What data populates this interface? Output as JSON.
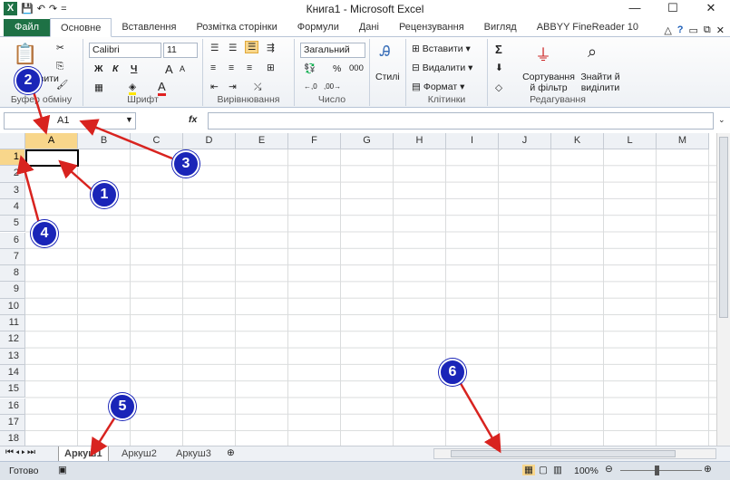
{
  "window": {
    "title": "Книга1 - Microsoft Excel",
    "controls": [
      "—",
      "☐",
      "✕"
    ],
    "qat": [
      "X",
      "💾",
      "↶",
      "↷",
      "="
    ]
  },
  "ribbon_tabs": [
    {
      "label": "Файл",
      "type": "file"
    },
    {
      "label": "Основне",
      "type": "active"
    },
    {
      "label": "Вставлення"
    },
    {
      "label": "Розмітка сторінки"
    },
    {
      "label": "Формули"
    },
    {
      "label": "Дані"
    },
    {
      "label": "Рецензування"
    },
    {
      "label": "Вигляд"
    },
    {
      "label": "ABBYY FineReader 10"
    }
  ],
  "ribbon_right_icons": [
    "△",
    "?",
    "▭",
    "⧉",
    "✕"
  ],
  "groups": {
    "clipboard": {
      "label": "Буфер обміну",
      "paste": "Вставити"
    },
    "font": {
      "label": "Шрифт",
      "font_name": "Calibri",
      "font_size": "11",
      "bold": "Ж",
      "italic": "К",
      "underline": "Ч",
      "grow": "A",
      "shrink": "A",
      "color_a": "A"
    },
    "alignment": {
      "label": "Вирівнювання"
    },
    "number": {
      "label": "Число",
      "format": "Загальний",
      "percent": "%",
      "thousands": "000"
    },
    "styles": {
      "label": "Стилі"
    },
    "cells": {
      "label": "Клітинки",
      "insert": "Вставити",
      "delete": "Видалити",
      "format": "Формат"
    },
    "editing": {
      "label": "Редагування",
      "sigma": "Σ",
      "sort": "Сортування й фільтр",
      "find": "Знайти й виділити"
    }
  },
  "formula_bar": {
    "name_box": "A1",
    "fx": "fx",
    "value": ""
  },
  "columns": [
    "A",
    "B",
    "C",
    "D",
    "E",
    "F",
    "G",
    "H",
    "I",
    "J",
    "K",
    "L",
    "M"
  ],
  "rows": [
    "1",
    "2",
    "3",
    "4",
    "5",
    "6",
    "7",
    "8",
    "9",
    "10",
    "11",
    "12",
    "13",
    "14",
    "15",
    "16",
    "17",
    "18"
  ],
  "sheets": {
    "tabs": [
      "Аркуш1",
      "Аркуш2",
      "Аркуш3"
    ],
    "active": "Аркуш1"
  },
  "status": {
    "ready": "Готово",
    "zoom": "100%"
  },
  "callouts": [
    "1",
    "2",
    "3",
    "4",
    "5",
    "6"
  ],
  "colors": {
    "accent": "#1e7145",
    "callout": "#1a25b8",
    "arrow": "#d8231f",
    "selection": "#f8d68b"
  }
}
